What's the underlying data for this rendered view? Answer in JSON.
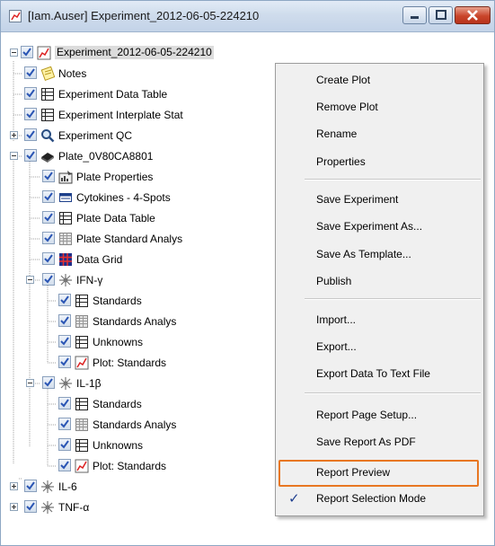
{
  "window": {
    "title": "[Iam.Auser] Experiment_2012-06-05-224210"
  },
  "tree": {
    "root": "Experiment_2012-06-05-224210",
    "items": {
      "notes": "Notes",
      "experiment_data_table": "Experiment Data Table",
      "interplate": "Experiment Interplate Stat",
      "qc": "Experiment QC",
      "plate": "Plate_0V80CA8801",
      "plate_properties": "Plate Properties",
      "cytokines": "Cytokines - 4-Spots",
      "plate_data_table": "Plate Data Table",
      "plate_standard": "Plate Standard Analys",
      "data_grid": "Data Grid",
      "ifn": "IFN-γ",
      "ifn_standards": "Standards",
      "ifn_standards_analysis": "Standards Analys",
      "ifn_unknowns": "Unknowns",
      "ifn_plot": "Plot: Standards",
      "il1": "IL-1β",
      "il1_standards": "Standards",
      "il1_standards_analysis": "Standards Analys",
      "il1_unknowns": "Unknowns",
      "il1_plot": "Plot: Standards",
      "il6": "IL-6",
      "tnf": "TNF-α"
    }
  },
  "context_menu": {
    "create_plot": "Create Plot",
    "remove_plot": "Remove Plot",
    "rename": "Rename",
    "properties": "Properties",
    "save_experiment": "Save Experiment",
    "save_experiment_as": "Save Experiment As...",
    "save_as_template": "Save As Template...",
    "publish": "Publish",
    "import": "Import...",
    "export": "Export...",
    "export_text": "Export Data To Text File",
    "report_page_setup": "Report Page Setup...",
    "save_report_pdf": "Save Report As PDF",
    "report_preview": "Report Preview",
    "report_selection_mode": "Report Selection Mode",
    "checkmark": "✓"
  },
  "colors": {
    "highlight_border": "#e87722",
    "checkbox_check": "#2a55b4"
  }
}
